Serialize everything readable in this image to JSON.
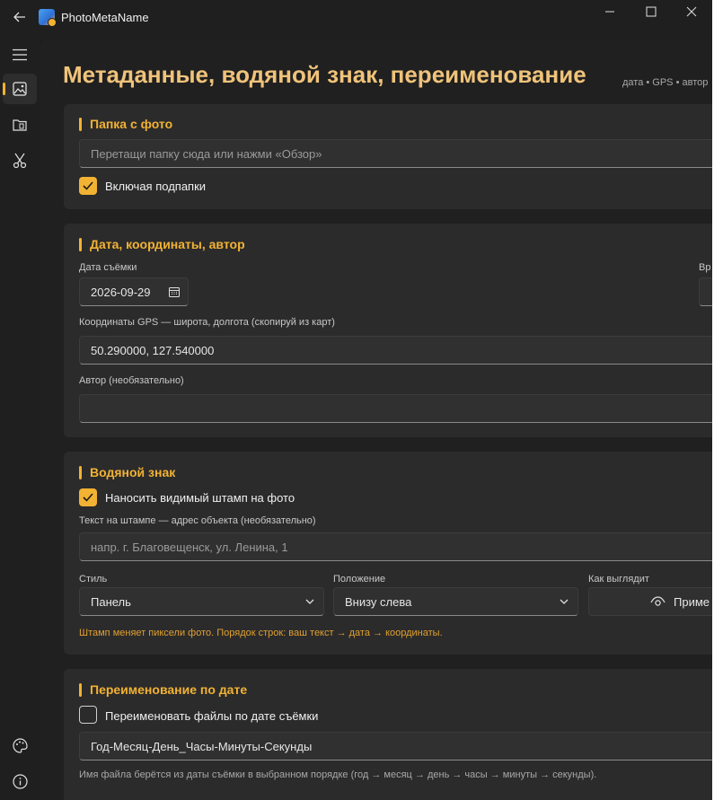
{
  "window": {
    "title": "PhotoMetaName"
  },
  "page": {
    "title": "Метаданные, водяной знак, переименование",
    "subtitle": "дата • GPS • автор"
  },
  "folder": {
    "title": "Папка с фото",
    "path_placeholder": "Перетащи папку сюда или нажми «Обзор»",
    "include_subfolders_label": "Включая подпапки",
    "include_subfolders": true
  },
  "meta": {
    "title": "Дата, координаты, автор",
    "date_label": "Дата съёмки",
    "date_value": "2026-09-29",
    "time_label": "Вр",
    "gps_label": "Координаты GPS — широта, долгота (скопируй из карт)",
    "gps_value": "50.290000, 127.540000",
    "author_label": "Автор (необязательно)",
    "author_value": ""
  },
  "watermark": {
    "title": "Водяной знак",
    "apply_label": "Наносить видимый штамп на фото",
    "apply": true,
    "text_label": "Текст на штампе — адрес объекта (необязательно)",
    "text_placeholder": "напр. г. Благовещенск, ул. Ленина, 1",
    "style_label": "Стиль",
    "style_value": "Панель",
    "position_label": "Положение",
    "position_value": "Внизу слева",
    "look_label": "Как выглядит",
    "preview_button": "Приме",
    "note": "Штамп меняет пиксели фото. Порядок строк: ваш текст → дата → координаты."
  },
  "rename": {
    "title": "Переименование по дате",
    "rename_label": "Переименовать файлы по дате съёмки",
    "rename": false,
    "pattern_value": "Год-Месяц-День_Часы-Минуты-Секунды",
    "note": "Имя файла берётся из даты съёмки в выбранном порядке (год → месяц → день → часы → минуты → секунды)."
  },
  "colors": {
    "accent": "#f2b233",
    "title": "#f0c37a",
    "note_warn": "#e0a030",
    "background": "#202020",
    "card": "#2b2b2b"
  },
  "icons": {
    "back": "arrow-left-icon",
    "app": "app-logo-icon",
    "menu": "hamburger-menu-icon",
    "nav_photo": "image-icon",
    "nav_folder": "folder-icon",
    "nav_cut": "scissors-icon",
    "theme": "palette-icon",
    "info": "info-icon",
    "calendar": "calendar-icon",
    "chevron": "chevron-down-icon",
    "eye": "eye-icon",
    "check": "checkmark-icon"
  }
}
